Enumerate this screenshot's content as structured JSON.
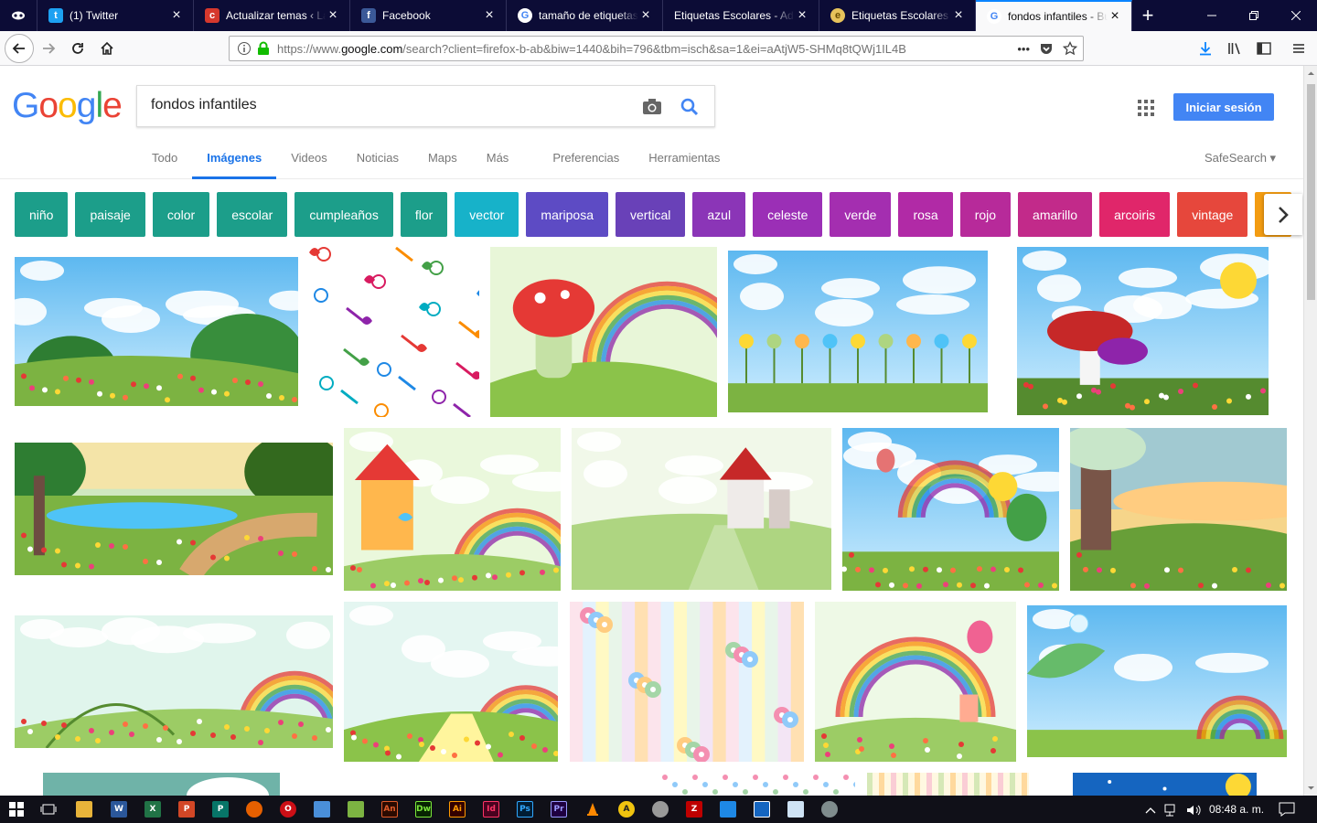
{
  "browser": {
    "tabs": [
      {
        "label": "(1) Twitter",
        "fav_color": "#1da1f2",
        "fav_glyph": "t"
      },
      {
        "label": "Actualizar temas ‹ La",
        "fav_color": "#d6382d",
        "fav_glyph": "c"
      },
      {
        "label": "Facebook",
        "fav_color": "#3b5998",
        "fav_glyph": "f"
      },
      {
        "label": "tamaño de etiquetas",
        "fav_color": "#ffffff",
        "fav_glyph": "G"
      },
      {
        "label": "Etiquetas Escolares - Adh",
        "fav_color": "",
        "fav_glyph": ""
      },
      {
        "label": "Etiquetas Escolares P",
        "fav_color": "#e7c35b",
        "fav_glyph": "e"
      },
      {
        "label": "fondos infantiles - Bu",
        "fav_color": "#ffffff",
        "fav_glyph": "G"
      }
    ],
    "url_prefix": "https://www.",
    "url_domain": "google.com",
    "url_rest": "/search?client=firefox-b-ab&biw=1440&bih=796&tbm=isch&sa=1&ei=aAtjW5-SHMq8tQWj1IL4B",
    "url_more": "•••"
  },
  "google": {
    "logo": "Google",
    "query": "fondos infantiles",
    "signin_label": "Iniciar sesión",
    "tabs": [
      {
        "label": "Todo",
        "active": false
      },
      {
        "label": "Imágenes",
        "active": true
      },
      {
        "label": "Videos",
        "active": false
      },
      {
        "label": "Noticias",
        "active": false
      },
      {
        "label": "Maps",
        "active": false
      },
      {
        "label": "Más",
        "active": false
      },
      {
        "label": "Preferencias",
        "active": false
      },
      {
        "label": "Herramientas",
        "active": false
      }
    ],
    "safesearch": "SafeSearch ▾"
  },
  "chips": [
    {
      "label": "niño",
      "color": "#1c9e8a"
    },
    {
      "label": "paisaje",
      "color": "#1c9e8a"
    },
    {
      "label": "color",
      "color": "#1c9e8a"
    },
    {
      "label": "escolar",
      "color": "#1c9e8a"
    },
    {
      "label": "cumpleaños",
      "color": "#1c9e8a"
    },
    {
      "label": "flor",
      "color": "#1c9e8a"
    },
    {
      "label": "vector",
      "color": "#17b2c9"
    },
    {
      "label": "mariposa",
      "color": "#5d4bc4"
    },
    {
      "label": "vertical",
      "color": "#6941b8"
    },
    {
      "label": "azul",
      "color": "#8b35b7"
    },
    {
      "label": "celeste",
      "color": "#9b2fb6"
    },
    {
      "label": "verde",
      "color": "#a42eb0"
    },
    {
      "label": "rosa",
      "color": "#b12aa6"
    },
    {
      "label": "rojo",
      "color": "#b72a9a"
    },
    {
      "label": "amarillo",
      "color": "#c22a8a"
    },
    {
      "label": "arcoiris",
      "color": "#e0266a"
    },
    {
      "label": "vintage",
      "color": "#e6473c"
    }
  ],
  "taskbar": {
    "clock": "08:48 a. m."
  }
}
